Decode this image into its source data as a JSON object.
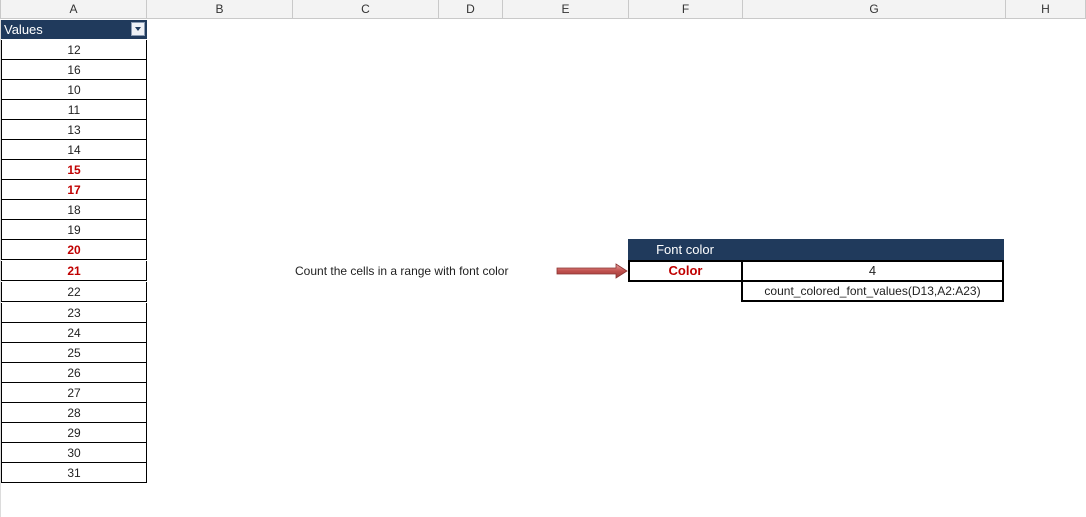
{
  "columns": [
    "A",
    "B",
    "C",
    "D",
    "E",
    "F",
    "G",
    "H"
  ],
  "values_header": "Values",
  "values": [
    {
      "v": "12",
      "red": false
    },
    {
      "v": "16",
      "red": false
    },
    {
      "v": "10",
      "red": false
    },
    {
      "v": "11",
      "red": false
    },
    {
      "v": "13",
      "red": false
    },
    {
      "v": "14",
      "red": false
    },
    {
      "v": "15",
      "red": true
    },
    {
      "v": "17",
      "red": true
    },
    {
      "v": "18",
      "red": false
    },
    {
      "v": "19",
      "red": false
    },
    {
      "v": "20",
      "red": true
    },
    {
      "v": "21",
      "red": true
    },
    {
      "v": "22",
      "red": false
    },
    {
      "v": "23",
      "red": false
    },
    {
      "v": "24",
      "red": false
    },
    {
      "v": "25",
      "red": false
    },
    {
      "v": "26",
      "red": false
    },
    {
      "v": "27",
      "red": false
    },
    {
      "v": "28",
      "red": false
    },
    {
      "v": "29",
      "red": false
    },
    {
      "v": "30",
      "red": false
    },
    {
      "v": "31",
      "red": false
    }
  ],
  "description": "Count the cells in a range with font color",
  "font_color_table": {
    "header": "Font color",
    "color_label": "Color",
    "result": "4",
    "formula": "count_colored_font_values(D13,A2:A23)"
  },
  "colors": {
    "header_bg": "#203a5c",
    "red_font": "#c00000",
    "arrow": "#c0504d"
  }
}
